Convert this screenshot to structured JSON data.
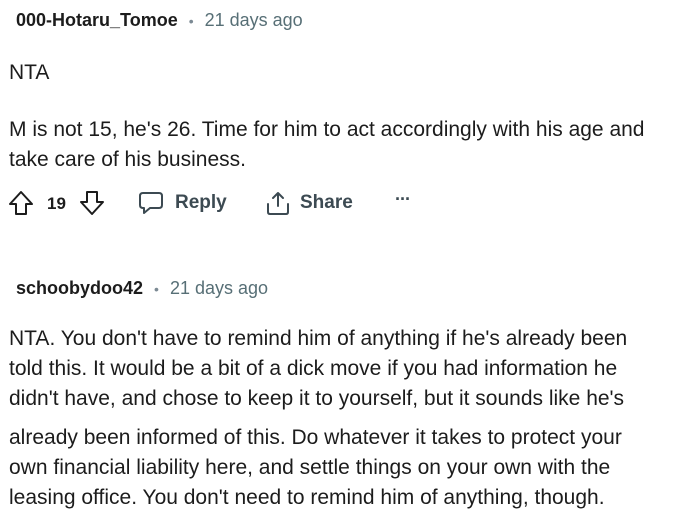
{
  "comments": [
    {
      "author": "000-Hotaru_Tomoe",
      "separator": "•",
      "time": "21 days ago",
      "paragraphs": [
        "NTA",
        "M is not 15, he's 26. Time for him to act accordingly with his age and",
        "take care of his business."
      ],
      "score": "19",
      "reply_label": "Reply",
      "share_label": "Share",
      "more_label": "···"
    },
    {
      "author": "schoobydoo42",
      "separator": "•",
      "time": "21 days ago",
      "paragraphs": [
        "NTA. You don't have to remind him of anything if he's already been",
        "told this. It would be a bit of a dick move if you had information he",
        "didn't have, and chose to keep it to yourself, but it sounds like he's",
        "already been informed of this. Do whatever it takes to protect your",
        "own financial liability here, and settle things on your own with the",
        "leasing office. You don't need to remind him of anything, though."
      ]
    }
  ],
  "icons": {
    "upvote": "upvote-arrow-icon",
    "downvote": "downvote-arrow-icon",
    "reply": "speech-bubble-icon",
    "share": "share-icon",
    "more": "ellipsis-icon"
  }
}
